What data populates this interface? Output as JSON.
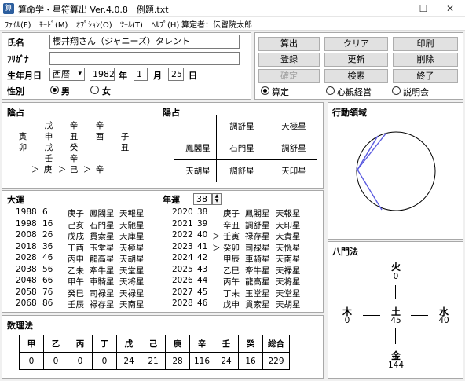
{
  "window": {
    "title": "算命学・星符算出 Ver.4.0.8　例題.txt",
    "min_glyph": "—",
    "max_glyph": "☐",
    "close_glyph": "✕"
  },
  "menu": {
    "items": [
      "ﾌｧｲﾙ(F)",
      "ﾓｰﾄﾞ(M)",
      "ｵﾌﾟｼｮﾝ(O)",
      "ﾂｰﾙ(T)",
      "ﾍﾙﾌﾟ(H)"
    ],
    "examiner": "算定者：伝習院太郎"
  },
  "form": {
    "name_label": "氏名",
    "name_value": "櫻井翔さん（ジャニーズ）タレント",
    "kana_label": "ﾌﾘｶﾞﾅ",
    "kana_value": "",
    "birth_label": "生年月日",
    "era": "西暦",
    "year": "1982",
    "year_unit": "年",
    "month": "1",
    "month_unit": "月",
    "day": "25",
    "day_unit": "日",
    "gender_label": "性別",
    "male": "男",
    "female": "女"
  },
  "buttons": {
    "calc": "算出",
    "clear": "クリア",
    "print": "印刷",
    "register": "登録",
    "update": "更新",
    "delete": "削除",
    "confirm": "確定",
    "search": "検索",
    "exit": "終了"
  },
  "mode": {
    "opt1": "算定",
    "opt2": "心観経営",
    "opt3": "説明会"
  },
  "inyo": {
    "title": "陰占",
    "rows": [
      [
        "",
        "戊",
        "辛",
        "辛",
        ""
      ],
      [
        "寅",
        "申",
        "丑",
        "酉",
        "子"
      ],
      [
        "卯",
        "戊",
        "癸",
        "",
        "丑"
      ],
      [
        "",
        "壬",
        "辛",
        "",
        ""
      ]
    ],
    "bottom": [
      "＞",
      "庚",
      "＞",
      "己",
      "＞",
      "辛"
    ]
  },
  "yosen": {
    "title": "陽占",
    "grid": [
      [
        "",
        "調舒星",
        "天極星"
      ],
      [
        "鳳閣星",
        "石門星",
        "調舒星"
      ],
      [
        "天胡星",
        "調舒星",
        "天印星"
      ]
    ]
  },
  "kodo": {
    "title": "行動領域"
  },
  "taiun": {
    "title": "大運",
    "left": [
      [
        "1988",
        "6",
        "",
        "庚子",
        "鳳閣星",
        "天報星"
      ],
      [
        "1998",
        "16",
        "",
        "己亥",
        "石門星",
        "天馳星"
      ],
      [
        "2008",
        "26",
        "",
        "戊戌",
        "貫索星",
        "天庫星"
      ],
      [
        "2018",
        "36",
        "",
        "丁酉",
        "玉堂星",
        "天極星"
      ],
      [
        "2028",
        "46",
        "",
        "丙申",
        "龍高星",
        "天胡星"
      ],
      [
        "2038",
        "56",
        "",
        "乙未",
        "牽牛星",
        "天堂星"
      ],
      [
        "2048",
        "66",
        "",
        "甲午",
        "車騎星",
        "天将星"
      ],
      [
        "2058",
        "76",
        "",
        "癸巳",
        "司禄星",
        "天禄星"
      ],
      [
        "2068",
        "86",
        "",
        "壬辰",
        "禄存星",
        "天南星"
      ]
    ],
    "nen_label": "年運",
    "nen_value": "38",
    "right": [
      [
        "2020",
        "38",
        "",
        "庚子",
        "鳳閣星",
        "天報星"
      ],
      [
        "2021",
        "39",
        "",
        "辛丑",
        "調舒星",
        "天印星"
      ],
      [
        "2022",
        "40",
        "＞",
        "壬寅",
        "禄存星",
        "天貴星"
      ],
      [
        "2023",
        "41",
        "＞",
        "癸卯",
        "司禄星",
        "天恍星"
      ],
      [
        "2024",
        "42",
        "",
        "甲辰",
        "車騎星",
        "天南星"
      ],
      [
        "2025",
        "43",
        "",
        "乙巳",
        "牽牛星",
        "天禄星"
      ],
      [
        "2026",
        "44",
        "",
        "丙午",
        "龍高星",
        "天将星"
      ],
      [
        "2027",
        "45",
        "",
        "丁未",
        "玉堂星",
        "天堂星"
      ],
      [
        "2028",
        "46",
        "",
        "戊申",
        "貫索星",
        "天胡星"
      ]
    ]
  },
  "suuri": {
    "title": "数理法",
    "headers": [
      "甲",
      "乙",
      "丙",
      "丁",
      "戊",
      "己",
      "庚",
      "辛",
      "壬",
      "癸",
      "総合"
    ],
    "values": [
      "0",
      "0",
      "0",
      "0",
      "24",
      "21",
      "28",
      "116",
      "24",
      "16",
      "229"
    ]
  },
  "hachimon": {
    "title": "八門法",
    "fire": "火",
    "fire_v": "0",
    "wood": "木",
    "wood_v": "0",
    "earth": "土",
    "earth_v": "45",
    "water": "水",
    "water_v": "40",
    "metal": "金",
    "metal_v": "144"
  }
}
